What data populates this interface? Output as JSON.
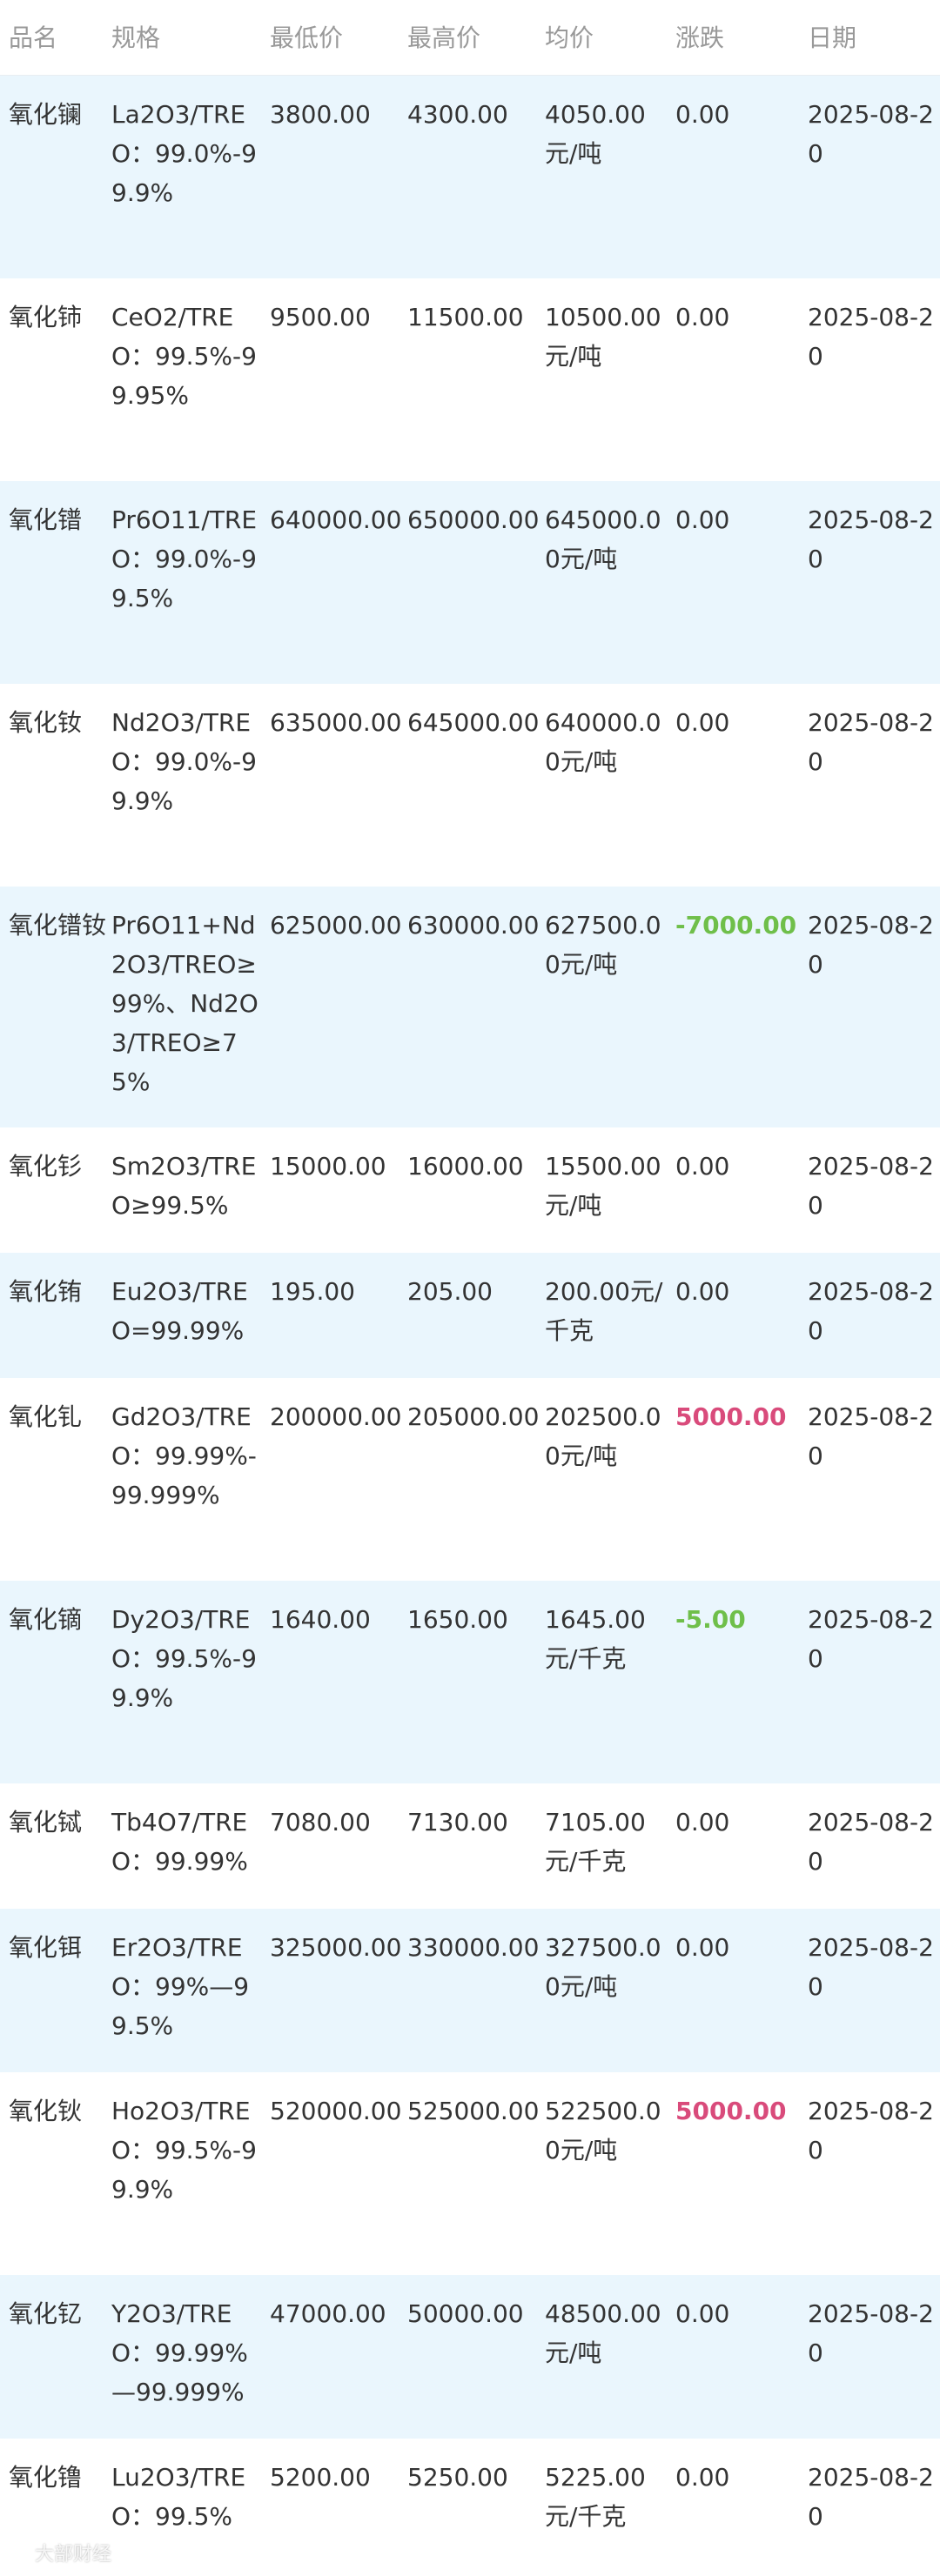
{
  "headers": {
    "name": "品名",
    "spec": "规格",
    "low": "最低价",
    "high": "最高价",
    "avg": "均价",
    "change": "涨跌",
    "date": "日期"
  },
  "rows": [
    {
      "name": "氧化镧",
      "spec": "La2O3/TREO：99.0%-99.9%",
      "low": "3800.00",
      "high": "4300.00",
      "avg": "4050.00元/吨",
      "change": "0.00",
      "trend": "flat",
      "date": "2025-08-20"
    },
    {
      "name": "氧化铈",
      "spec": "CeO2/TREO：99.5%-99.95%",
      "low": "9500.00",
      "high": "11500.00",
      "avg": "10500.00元/吨",
      "change": "0.00",
      "trend": "flat",
      "date": "2025-08-20"
    },
    {
      "name": "氧化镨",
      "spec": "Pr6O11/TREO：99.0%-99.5%",
      "low": "640000.00",
      "high": "650000.00",
      "avg": "645000.00元/吨",
      "change": "0.00",
      "trend": "flat",
      "date": "2025-08-20"
    },
    {
      "name": "氧化钕",
      "spec": "Nd2O3/TREO：99.0%-99.9%",
      "low": "635000.00",
      "high": "645000.00",
      "avg": "640000.00元/吨",
      "change": "0.00",
      "trend": "flat",
      "date": "2025-08-20"
    },
    {
      "name": "氧化镨钕",
      "spec": "Pr6O11+Nd2O3/TREO≥99%、Nd2O3/TREO≥75%",
      "low": "625000.00",
      "high": "630000.00",
      "avg": "627500.00元/吨",
      "change": "-7000.00",
      "trend": "down",
      "date": "2025-08-20"
    },
    {
      "name": "氧化钐",
      "spec": "Sm2O3/TREO≥99.5%",
      "low": "15000.00",
      "high": "16000.00",
      "avg": "15500.00元/吨",
      "change": "0.00",
      "trend": "flat",
      "date": "2025-08-20"
    },
    {
      "name": "氧化铕",
      "spec": "Eu2O3/TREO=99.99%",
      "low": "195.00",
      "high": "205.00",
      "avg": "200.00元/千克",
      "change": "0.00",
      "trend": "flat",
      "date": "2025-08-20"
    },
    {
      "name": "氧化钆",
      "spec": "Gd2O3/TREO：99.99%-99.999%",
      "low": "200000.00",
      "high": "205000.00",
      "avg": "202500.00元/吨",
      "change": "5000.00",
      "trend": "up",
      "date": "2025-08-20"
    },
    {
      "name": "氧化镝",
      "spec": "Dy2O3/TREO：99.5%-99.9%",
      "low": "1640.00",
      "high": "1650.00",
      "avg": "1645.00元/千克",
      "change": "-5.00",
      "trend": "down",
      "date": "2025-08-20"
    },
    {
      "name": "氧化铽",
      "spec": "Tb4O7/TREO：99.99%",
      "low": "7080.00",
      "high": "7130.00",
      "avg": "7105.00元/千克",
      "change": "0.00",
      "trend": "flat",
      "date": "2025-08-20"
    },
    {
      "name": "氧化铒",
      "spec": "Er2O3/TREO：99%—99.5%",
      "low": "325000.00",
      "high": "330000.00",
      "avg": "327500.00元/吨",
      "change": "0.00",
      "trend": "flat",
      "date": "2025-08-20"
    },
    {
      "name": "氧化钬",
      "spec": "Ho2O3/TREO：99.5%-99.9%",
      "low": "520000.00",
      "high": "525000.00",
      "avg": "522500.00元/吨",
      "change": "5000.00",
      "trend": "up",
      "date": "2025-08-20"
    },
    {
      "name": "氧化钇",
      "spec": "Y2O3/TREO：99.99%—99.999%",
      "low": "47000.00",
      "high": "50000.00",
      "avg": "48500.00元/吨",
      "change": "0.00",
      "trend": "flat",
      "date": "2025-08-20"
    },
    {
      "name": "氧化镥",
      "spec": "Lu2O3/TREO：99.5%",
      "low": "5200.00",
      "high": "5250.00",
      "avg": "5225.00元/千克",
      "change": "0.00",
      "trend": "flat",
      "date": "2025-08-20"
    }
  ],
  "colors": {
    "row_shade": "#eaf6fd",
    "header_text": "#999999",
    "body_text": "#333333",
    "change_up": "#d94b7b",
    "change_down": "#6fbf4a"
  },
  "watermark": {
    "text": "大部财经",
    "icon": "weibo-logo-icon"
  }
}
